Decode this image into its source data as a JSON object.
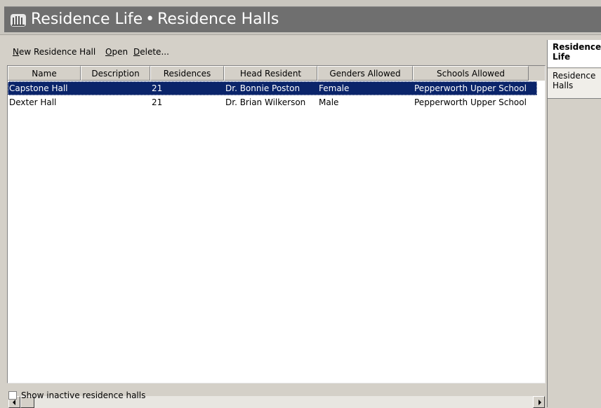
{
  "window": {
    "title_part1": "Residence Life",
    "separator": "•",
    "title_part2": "Residence Halls",
    "icon": "residence-halls-icon"
  },
  "toolbar": {
    "new_label_underlined": "N",
    "new_label_rest": "ew Residence Hall",
    "open_label_underlined": "O",
    "open_label_rest": "pen",
    "delete_label_underlined": "D",
    "delete_label_rest": "elete..."
  },
  "table": {
    "columns": [
      "Name",
      "Description",
      "Residences",
      "Head Resident",
      "Genders Allowed",
      "Schools Allowed"
    ],
    "rows": [
      {
        "name": "Capstone Hall",
        "description": "",
        "residences": "21",
        "head_resident": "Dr. Bonnie Poston",
        "genders": "Female",
        "schools": "Pepperworth Upper School",
        "selected": true
      },
      {
        "name": "Dexter Hall",
        "description": "",
        "residences": "21",
        "head_resident": "Dr. Brian Wilkerson",
        "genders": "Male",
        "schools": "Pepperworth Upper School",
        "selected": false
      }
    ]
  },
  "options": {
    "show_inactive_label": "Show inactive residence halls",
    "show_inactive_checked": false
  },
  "sidebar": {
    "items": [
      {
        "label": "Residence Life"
      },
      {
        "label": "Residence Halls"
      }
    ]
  },
  "colors": {
    "selection": "#0a246a",
    "titlebar": "#6f6f6f"
  }
}
